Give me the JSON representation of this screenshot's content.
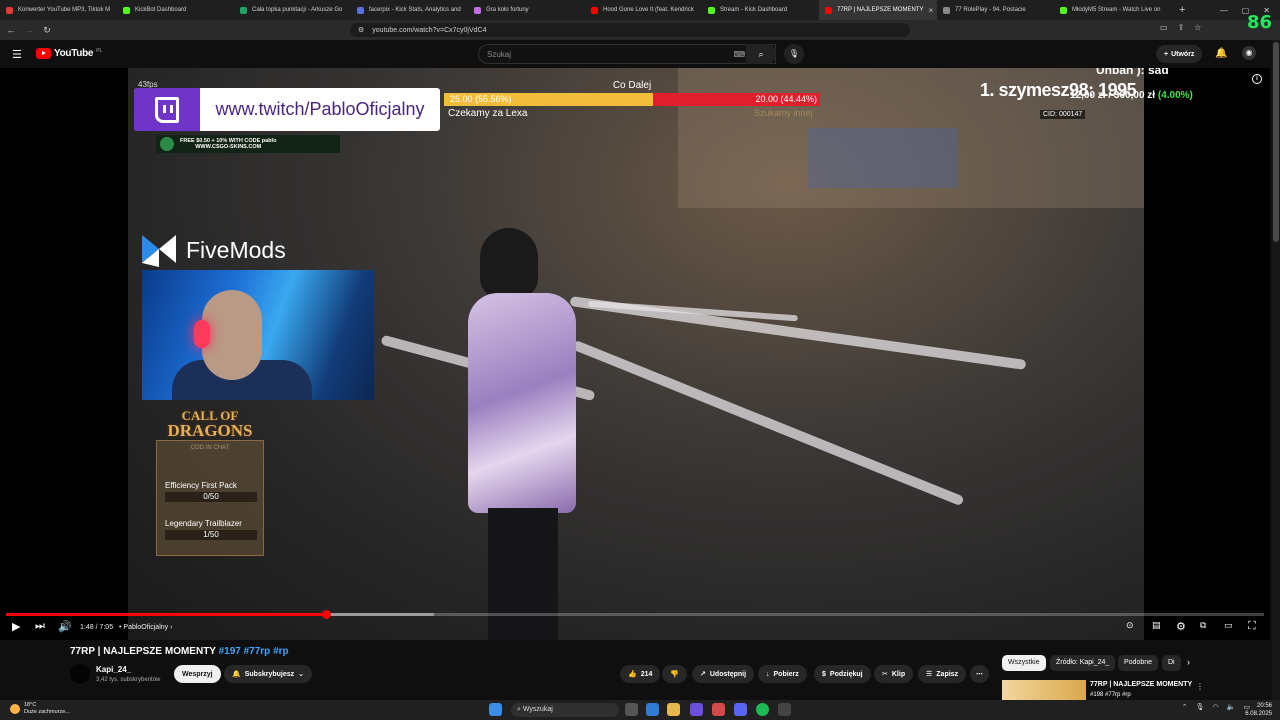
{
  "browser": {
    "tabs": [
      {
        "label": "Konwerter YouTube MP3, Tiktok M",
        "color": "#e53935"
      },
      {
        "label": "KickBot Dashboard",
        "color": "#53fc18"
      },
      {
        "label": "Cała topka punktacji - Arkusze Go",
        "color": "#1ea362"
      },
      {
        "label": "facerpix - Kick Stats, Analytics and",
        "color": "#5b6ee1"
      },
      {
        "label": "Gra koło fortuny",
        "color": "#c66be8"
      },
      {
        "label": "Hood Gone Love It (feat. Kendrick",
        "color": "#ff0000"
      },
      {
        "label": "Stream - Kick Dashboard",
        "color": "#53fc18"
      },
      {
        "label": "77RP | NAJLEPSZE MOMENTY",
        "color": "#ff0000"
      },
      {
        "label": "77 RolePlay - 94. Postacie",
        "color": "#888888"
      },
      {
        "label": "MłodyM5 Stream - Watch Live on",
        "color": "#53fc18"
      }
    ],
    "active_tab_index": 7,
    "url": "youtube.com/watch?v=Cx7cy0jVdC4",
    "fps_overlay": "86"
  },
  "youtube": {
    "logo_text": "YouTube",
    "logo_country": "PL",
    "search_placeholder": "Szukaj",
    "create_label": "Utwórz"
  },
  "stream_overlay": {
    "fps_text": "43fps",
    "twitch_url": "www.twitch/PabloOficjalny",
    "promo_line1": "FREE $0.50 + 10% WITH CODE pablo",
    "promo_line2": "WWW.CSGO-SKINS.COM",
    "poll": {
      "title": "Co Dalej",
      "left_text": "25.00 (55.56%)",
      "right_text": "20.00 (44.44%)",
      "left_share": 0.5556,
      "option1": "Czekamy za Lexa",
      "option2": "Szukamy innej"
    },
    "leader_text": "1. szymesz98: 1995",
    "leader_amount": "12,00 zł / 300,00 zł",
    "leader_pct": "(4.00%)",
    "cid": "CID: 000147",
    "unban": "Unban ): sad",
    "fivemods": "FiveMods",
    "dragons": {
      "title_line1": "CALL OF",
      "title_line2": "DRAGONS",
      "cod_label": "COD IN CHAT",
      "item1_name": "Efficiency First Pack",
      "item1_count": "0/50",
      "item2_name": "Legendary Trailblazer",
      "item2_count": "1/50"
    }
  },
  "player": {
    "current_time": "1:48",
    "duration": "7:05",
    "time_label": "1:48 / 7:05",
    "chapter": "PabloOficjalny",
    "played_fraction": 0.254,
    "buffered_fraction": 0.34
  },
  "video": {
    "title": "77RP | NAJLEPSZE MOMENTY",
    "tags": "#197 #77rp #rp",
    "channel": "Kapi_24_",
    "subscribers": "3,42 tys. subskrybentów",
    "support_label": "Wesprzyj",
    "subscribed_label": "Subskrybujesz",
    "likes": "214",
    "share_label": "Udostępnij",
    "download_label": "Pobierz",
    "thanks_label": "Podziękuj",
    "clip_label": "Klip",
    "save_label": "Zapisz"
  },
  "sidebar": {
    "chips": [
      "Wszystkie",
      "Źródło: Kapi_24_",
      "Podobne",
      "Di"
    ],
    "rec_title": "77RP | NAJLEPSZE MOMENTY",
    "rec_tags": "#198 #77rp #rp"
  },
  "taskbar": {
    "temp": "18°C",
    "weather": "Duże zachmurze...",
    "search_label": "Wyszukaj",
    "time": "20:56",
    "date": "6.08.2025"
  }
}
